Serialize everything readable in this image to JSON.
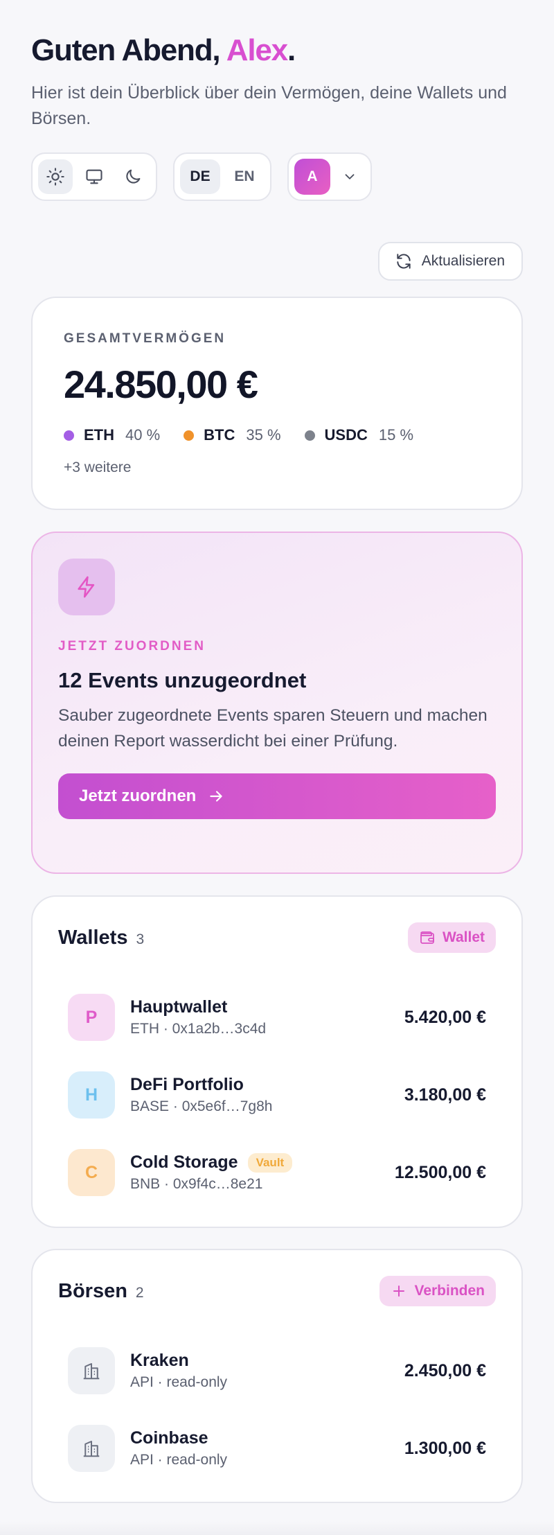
{
  "header": {
    "greeting_prefix": "Guten Abend, ",
    "greeting_name": "Alex",
    "greeting_suffix": ".",
    "subtitle": "Hier ist dein Überblick über dein Vermögen, deine Wallets und Börsen."
  },
  "controls": {
    "theme_options": [
      "light",
      "system",
      "dark"
    ],
    "theme_selected": "light",
    "languages": [
      "DE",
      "EN"
    ],
    "language_selected": "DE",
    "avatar_initial": "A"
  },
  "refresh": {
    "label": "Aktualisieren"
  },
  "total": {
    "eyebrow": "GESAMTVERMÖGEN",
    "value": "24.850,00 €",
    "allocations": [
      {
        "symbol": "ETH",
        "percent": "40 %",
        "color": "#a45ee5"
      },
      {
        "symbol": "BTC",
        "percent": "35 %",
        "color": "#f0922b"
      },
      {
        "symbol": "USDC",
        "percent": "15 %",
        "color": "#7d828c"
      }
    ],
    "more": "+3 weitere"
  },
  "promo": {
    "icon": "lightning-icon",
    "eyebrow": "JETZT ZUORDNEN",
    "title": "12 Events unzugeordnet",
    "text": "Sauber zugeordnete Events sparen Steuern und machen deinen Report wasserdicht bei einer Prüfung.",
    "button_label": "Jetzt zuordnen"
  },
  "wallets": {
    "title": "Wallets",
    "count": "3",
    "add_label": "Wallet",
    "items": [
      {
        "initial": "P",
        "name": "Hauptwallet",
        "sub": "ETH · 0x1a2b…3c4d",
        "value": "5.420,00 €",
        "bg": "#f7dbf4",
        "fg": "#df5bc9",
        "badge": ""
      },
      {
        "initial": "H",
        "name": "DeFi Portfolio",
        "sub": "BASE · 0x5e6f…7g8h",
        "value": "3.180,00 €",
        "bg": "#d8eefb",
        "fg": "#6cc0ee",
        "badge": ""
      },
      {
        "initial": "C",
        "name": "Cold Storage",
        "sub": "BNB · 0x9f4c…8e21",
        "value": "12.500,00 €",
        "bg": "#fde8cf",
        "fg": "#f4ac4f",
        "badge": "Vault"
      }
    ]
  },
  "exchanges": {
    "title": "Börsen",
    "count": "2",
    "add_label": "Verbinden",
    "items": [
      {
        "icon": "building-icon",
        "name": "Kraken",
        "sub": "API · read-only",
        "value": "2.450,00 €"
      },
      {
        "icon": "building-icon",
        "name": "Coinbase",
        "sub": "API · read-only",
        "value": "1.300,00 €"
      }
    ]
  }
}
